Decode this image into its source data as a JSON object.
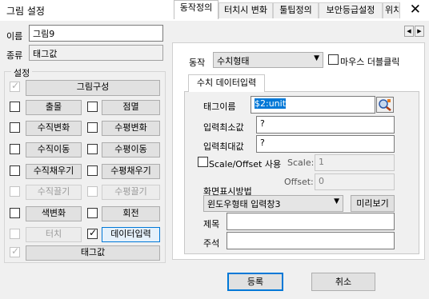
{
  "window": {
    "title": "그림 설정",
    "close_symbol": "✕"
  },
  "left": {
    "name_label": "이름",
    "name_value": "그림9",
    "type_label": "종류",
    "type_value": "태그값",
    "settings_group": "설정",
    "composition_button": "그림구성",
    "options": {
      "blink": "출몰",
      "flash": "점멸",
      "vertical_change": "수직변화",
      "horizontal_change": "수평변화",
      "vertical_move": "수직이동",
      "horizontal_move": "수평이동",
      "vertical_fill": "수직채우기",
      "horizontal_fill": "수평채우기",
      "vertical_drag": "수직끌기",
      "horizontal_drag": "수평끌기",
      "color_change": "색변화",
      "rotate": "회전",
      "touch": "터치",
      "data_input": "데이터입력",
      "tag_value": "태그값"
    },
    "check_mark": "✓"
  },
  "tabs": [
    "동작정의",
    "터치시 변화",
    "툴팁정의",
    "보안등급설정",
    "위치"
  ],
  "tab_scroll": {
    "left": "◀",
    "right": "▶"
  },
  "panel": {
    "action_label": "동작",
    "action_value": "수치형태",
    "mouse_dblclick_label": "마우스 더블클릭",
    "inner_tab": "수치 데이터입력",
    "tag_name_label": "태그이름",
    "tag_name_value": "$2:unit",
    "input_min_label": "입력최소값",
    "input_min_value": "?",
    "input_max_label": "입력최대값",
    "input_max_value": "?",
    "scale_offset_label": "Scale/Offset 사용",
    "scale_label": "Scale:",
    "scale_value": "1",
    "offset_label": "Offset:",
    "offset_value": "0",
    "display_method_label": "화면표시방법",
    "display_method_value": "윈도우형태 입력창3",
    "preview_button": "미리보기",
    "title_label": "제목",
    "title_value": "",
    "comment_label": "주석",
    "comment_value": ""
  },
  "footer": {
    "ok_button": "등록",
    "cancel_button": "취소"
  }
}
